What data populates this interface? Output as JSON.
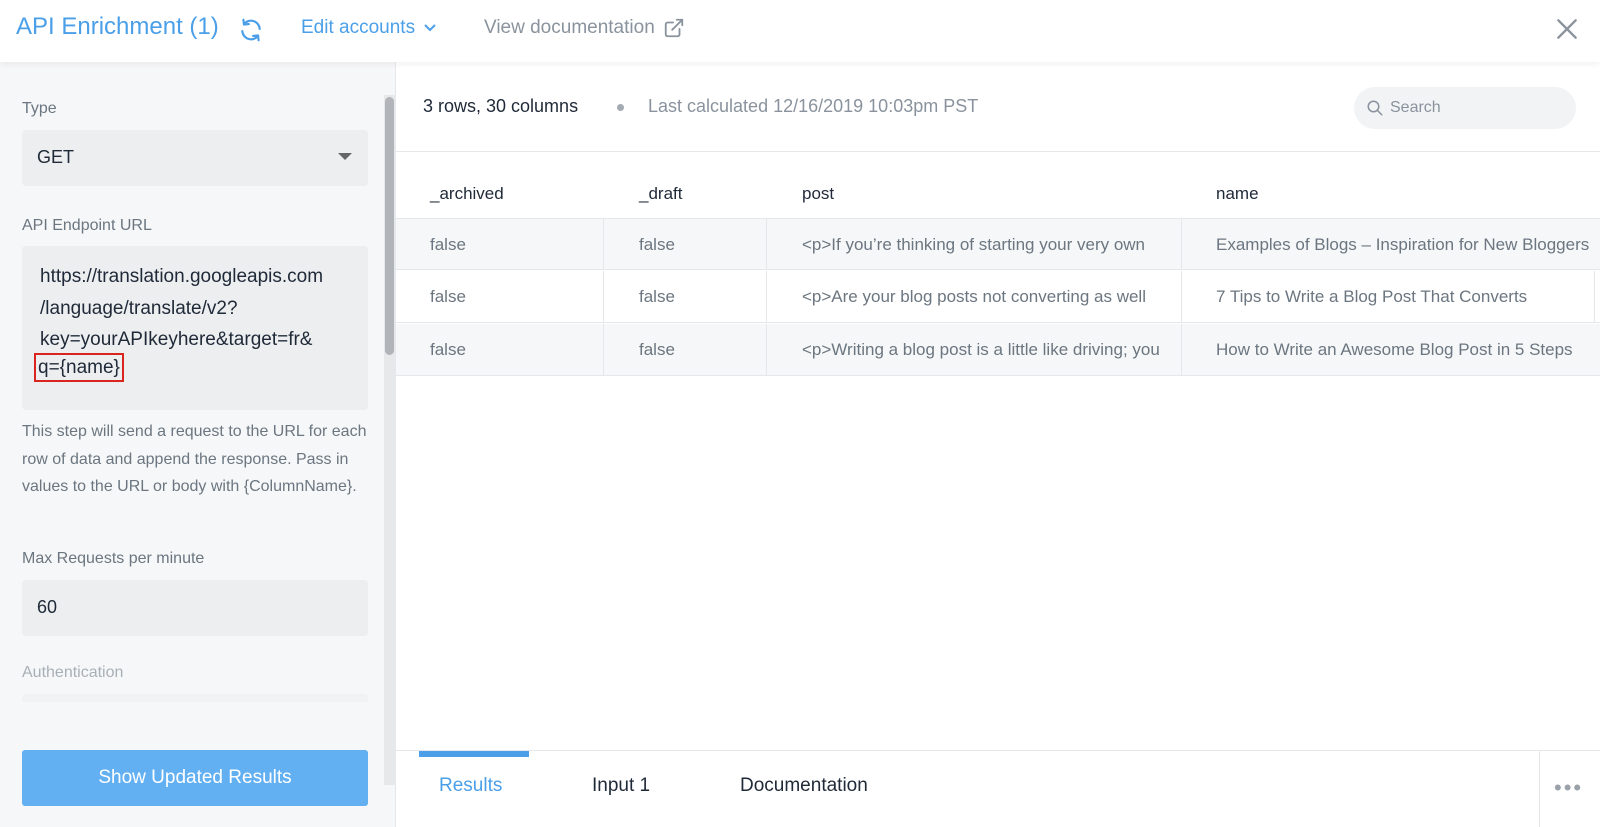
{
  "header": {
    "title": "API Enrichment (1)",
    "edit_accounts": "Edit accounts",
    "view_documentation": "View documentation",
    "icons": {
      "refresh": "refresh-icon",
      "chevron": "chevron-down-icon",
      "external": "external-link-icon",
      "close": "close-icon"
    },
    "accent_color": "#4a9fe8"
  },
  "form": {
    "type_label": "Type",
    "type_value": "GET",
    "url_label": "API Endpoint URL",
    "url_lines": [
      "https://translation.googleapis.com",
      "/language/translate/v2?",
      "key=yourAPIkeyhere&target=fr&",
      "q={name}"
    ],
    "help_text": "This step will send a request to the URL for each row of data and append the response. Pass in values to the URL or body with {ColumnName}.",
    "max_requests_label": "Max Requests per minute",
    "max_requests_value": "60",
    "auth_label": "Authentication",
    "submit_label": "Show Updated Results",
    "button_color": "#62b0f2",
    "highlight_color": "#d9251d"
  },
  "results": {
    "stats": "3 rows, 30 columns",
    "last_calculated": "Last calculated 12/16/2019 10:03pm PST",
    "search_placeholder": "Search",
    "columns": [
      "_archived",
      "_draft",
      "post",
      "name"
    ],
    "rows": [
      [
        "false",
        "false",
        "<p>If you’re thinking of starting your very own",
        "Examples of Blogs – Inspiration for New Bloggers"
      ],
      [
        "false",
        "false",
        "<p>Are your blog posts not converting as well",
        "7 Tips to Write a Blog Post That Converts"
      ],
      [
        "false",
        "false",
        "<p>Writing a blog post is a little like driving; you",
        "How to Write an Awesome Blog Post in 5 Steps"
      ]
    ]
  },
  "tabs": {
    "items": [
      "Results",
      "Input 1",
      "Documentation"
    ],
    "active": "Results",
    "more": "•••"
  }
}
